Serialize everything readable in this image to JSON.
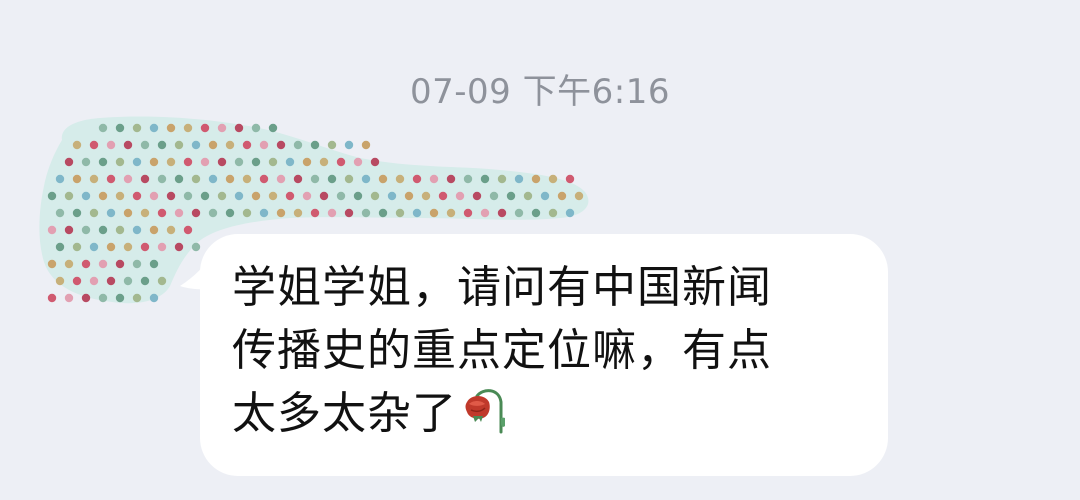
{
  "chat": {
    "timestamp": "07-09 下午6:16",
    "message": {
      "text": "学姐学姐，请问有中国新闻\n传播史的重点定位嘛，有点\n太多太杂了",
      "trailing_emoji": "wilted-rose-icon"
    }
  },
  "colors": {
    "background": "#edeff5",
    "bubble": "#ffffff",
    "timestamp_text": "#8e929b",
    "message_text": "#111111",
    "mask_base": "#d6ecea"
  }
}
